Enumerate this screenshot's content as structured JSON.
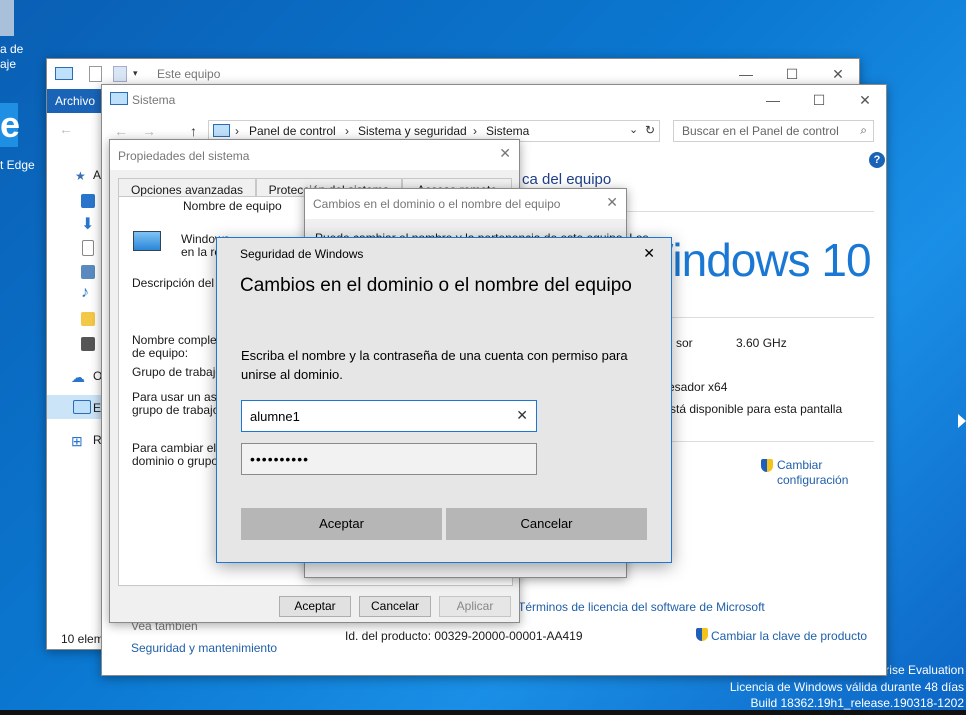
{
  "desktop": {
    "icon1_label": "a de\naje",
    "edge_label": "t Edge",
    "watermark": {
      "line1": "rise Evaluation",
      "line2": "Licencia de Windows válida durante 48 días",
      "line3": "Build 18362.19h1_release.190318-1202"
    }
  },
  "explorer": {
    "title": "Este equipo",
    "ribbon_tab": "Archivo",
    "nav_items": [
      "Ac",
      "",
      "",
      "",
      "",
      "",
      "",
      "O",
      "Es",
      "Re"
    ],
    "status": "10 elem"
  },
  "sistema": {
    "title": "Sistema",
    "breadcrumb": [
      "Panel de control",
      "Sistema y seguridad",
      "Sistema"
    ],
    "search_placeholder": "Buscar en el Panel de control",
    "help": "?",
    "heading_frag": "ca del equipo",
    "win10": "Windows 10",
    "rows": [
      {
        "label": "sor",
        "value": "3.60 GHz"
      },
      {
        "label": "esador x64",
        "value": ""
      },
      {
        "label": "stá disponible para esta pantalla",
        "value": ""
      }
    ],
    "cambiar_config": "Cambiar\nconfiguración",
    "licencia_link": "Términos de licencia del software de Microsoft",
    "product_id": "Id. del producto: 00329-20000-00001-AA419",
    "cambiar_clave": "Cambiar la clave de producto",
    "vea_tambien": "Vea también",
    "seguridad": "Seguridad y mantenimiento"
  },
  "propiedades": {
    "title": "Propiedades del sistema",
    "tabs": [
      "Opciones avanzadas",
      "Protección del sistema",
      "Acceso remoto"
    ],
    "subtab": "Nombre de equipo",
    "windows_text": "Windows\nen la re",
    "descripcion": "Descripción del eq",
    "nombre_completo": "Nombre completo\nde equipo:",
    "grupo_trabajo": "Grupo de trabajo:",
    "para_usar": "Para usar un asist\ngrupo de trabajo, h",
    "para_cambiar": "Para cambiar el no\ndominio o grupo de",
    "btn_aceptar": "Aceptar",
    "btn_cancelar": "Cancelar",
    "btn_aplicar": "Aplicar"
  },
  "cambios": {
    "title": "Cambios en el dominio o el nombre del equipo",
    "text": "Puede cambiar el nombre y la pertenencia de este equipo. Los"
  },
  "seguridad_dialog": {
    "title": "Seguridad de Windows",
    "heading": "Cambios en el dominio o el nombre del equipo",
    "message": "Escriba el nombre y la contraseña de una cuenta con permiso para unirse al dominio.",
    "username": "alumne1",
    "password": "••••••••••",
    "accept": "Aceptar",
    "cancel": "Cancelar"
  }
}
